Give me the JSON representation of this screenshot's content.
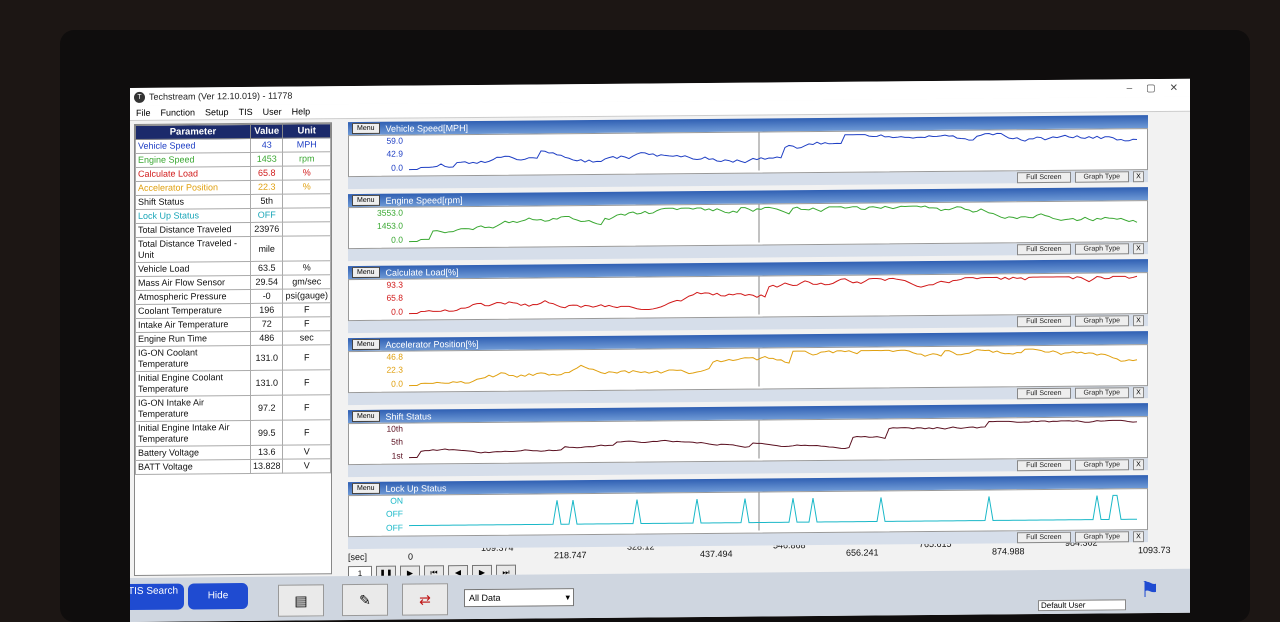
{
  "window": {
    "title": "Techstream (Ver 12.10.019) - 11778",
    "controls": [
      "–",
      "▢",
      "✕"
    ]
  },
  "menubar": [
    "File",
    "Function",
    "Setup",
    "TIS",
    "User",
    "Help"
  ],
  "table": {
    "headers": [
      "Parameter",
      "Value",
      "Unit"
    ],
    "rows": [
      {
        "param": "Vehicle Speed",
        "value": "43",
        "unit": "MPH",
        "color": "#1f3fc4"
      },
      {
        "param": "Engine Speed",
        "value": "1453",
        "unit": "rpm",
        "color": "#3aa832"
      },
      {
        "param": "Calculate Load",
        "value": "65.8",
        "unit": "%",
        "color": "#d11a1a"
      },
      {
        "param": "Accelerator Position",
        "value": "22.3",
        "unit": "%",
        "color": "#e0a010"
      },
      {
        "param": "Shift Status",
        "value": "5th",
        "unit": "",
        "color": "#111111"
      },
      {
        "param": "Lock Up Status",
        "value": "OFF",
        "unit": "",
        "color": "#1aa6b8"
      },
      {
        "param": "Total Distance Traveled",
        "value": "23976",
        "unit": "",
        "color": "#111111"
      },
      {
        "param": "Total Distance Traveled - Unit",
        "value": "mile",
        "unit": "",
        "color": "#111111"
      },
      {
        "param": "Vehicle Load",
        "value": "63.5",
        "unit": "%",
        "color": "#111111"
      },
      {
        "param": "Mass Air Flow Sensor",
        "value": "29.54",
        "unit": "gm/sec",
        "color": "#111111"
      },
      {
        "param": "Atmospheric Pressure",
        "value": "-0",
        "unit": "psi(gauge)",
        "color": "#111111"
      },
      {
        "param": "Coolant Temperature",
        "value": "196",
        "unit": "F",
        "color": "#111111"
      },
      {
        "param": "Intake Air Temperature",
        "value": "72",
        "unit": "F",
        "color": "#111111"
      },
      {
        "param": "Engine Run Time",
        "value": "486",
        "unit": "sec",
        "color": "#111111"
      },
      {
        "param": "IG-ON Coolant Temperature",
        "value": "131.0",
        "unit": "F",
        "color": "#111111"
      },
      {
        "param": "Initial Engine Coolant Temperature",
        "value": "131.0",
        "unit": "F",
        "color": "#111111"
      },
      {
        "param": "IG-ON Intake Air Temperature",
        "value": "97.2",
        "unit": "F",
        "color": "#111111"
      },
      {
        "param": "Initial Engine Intake Air Temperature",
        "value": "99.5",
        "unit": "F",
        "color": "#111111"
      },
      {
        "param": "Battery Voltage",
        "value": "13.6",
        "unit": "V",
        "color": "#111111"
      },
      {
        "param": "BATT Voltage",
        "value": "13.828",
        "unit": "V",
        "color": "#111111"
      }
    ]
  },
  "graph_buttons": {
    "menu": "Menu",
    "full_screen": "Full Screen",
    "graph_type": "Graph Type",
    "close": "X"
  },
  "graphs": [
    {
      "title": "Vehicle Speed[MPH]",
      "color": "#1f3fc4",
      "ylabels": [
        "59.0",
        "42.9",
        "0.0"
      ],
      "seed": 1
    },
    {
      "title": "Engine Speed[rpm]",
      "color": "#3aa832",
      "ylabels": [
        "3553.0",
        "1453.0",
        "0.0"
      ],
      "seed": 2
    },
    {
      "title": "Calculate Load[%]",
      "color": "#d11a1a",
      "ylabels": [
        "93.3",
        "65.8",
        "0.0"
      ],
      "seed": 3
    },
    {
      "title": "Accelerator Position[%]",
      "color": "#e0a010",
      "ylabels": [
        "46.8",
        "22.3",
        "0.0"
      ],
      "seed": 4
    },
    {
      "title": "Shift Status",
      "color": "#5a1020",
      "ylabels": [
        "10th",
        "5th",
        "1st"
      ],
      "seed": 5
    },
    {
      "title": "Lock Up Status",
      "color": "#1ab8c8",
      "ylabels": [
        "ON",
        "OFF",
        "OFF"
      ],
      "seed": 6
    }
  ],
  "xaxis": {
    "unit": "[sec]",
    "ticks": [
      "0",
      "109.374",
      "218.747",
      "328.12",
      "437.494",
      "546.868",
      "656.241",
      "765.615",
      "874.988",
      "984.362",
      "1093.73"
    ]
  },
  "transport": {
    "step": "1",
    "buttons": [
      "❚❚",
      "▶",
      "⏮",
      "◀",
      "▶",
      "⏭"
    ]
  },
  "bottom": {
    "tis_search": "TIS Search",
    "hide": "Hide",
    "dropdown": "All Data",
    "user": "Default User"
  }
}
